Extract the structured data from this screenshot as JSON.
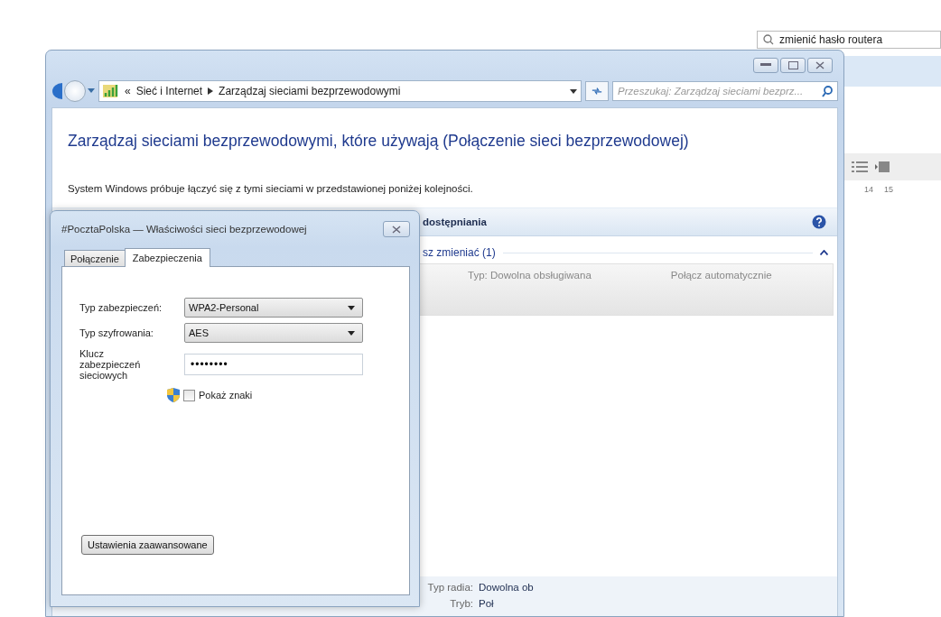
{
  "browser": {
    "search_text": "zmienić hasło routera",
    "ruler_labels": [
      "14",
      "15"
    ]
  },
  "explorer": {
    "address": {
      "overflow": "«",
      "crumbs": [
        "Sieć i Internet",
        "Zarządzaj sieciami bezprzewodowymi"
      ]
    },
    "search": {
      "placeholder": "Przeszukaj: Zarządzaj sieciami bezprz..."
    },
    "heading": "Zarządzaj sieciami bezprzewodowymi, które używają (Połączenie sieci bezprzewodowej)",
    "description": "System Windows próbuje łączyć się z tymi sieciami w przedstawionej poniżej kolejności.",
    "toolbar_text": "dostępniania",
    "group": {
      "title": "sz zmieniać (1)",
      "expanded": true
    },
    "network_row": {
      "type": "Typ: Dowolna obsługiwana",
      "mode": "Połącz automatycznie"
    },
    "details": [
      {
        "label": "Typ radia:",
        "value": "Dowolna ob"
      },
      {
        "label": "Tryb:",
        "value": "Poł"
      }
    ]
  },
  "dialog": {
    "title": "#PocztaPolska — Właściwości sieci bezprzewodowej",
    "tabs": [
      {
        "label": "Połączenie",
        "selected": false
      },
      {
        "label": "Zabezpieczenia",
        "selected": true
      }
    ],
    "fields": [
      {
        "kind": "select",
        "label": "Typ zabezpieczeń:",
        "value": "WPA2-Personal"
      },
      {
        "kind": "select",
        "label": "Typ szyfrowania:",
        "value": "AES"
      },
      {
        "kind": "password",
        "label": "Klucz zabezpieczeń sieciowych",
        "value": "••••••••"
      }
    ],
    "show_chars": {
      "label": "Pokaż znaki",
      "checked": false
    },
    "advanced_button": "Ustawienia zaawansowane"
  }
}
